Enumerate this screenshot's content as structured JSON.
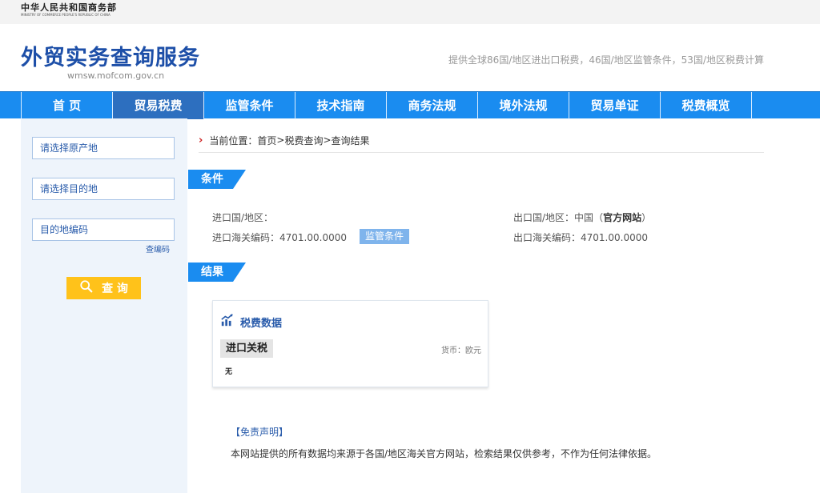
{
  "ministry": {
    "name_cn": "中华人民共和国商务部",
    "name_en": "MINISTRY OF COMMERCE PEOPLE'S REPUBLIC OF CHINA"
  },
  "header": {
    "title": "外贸实务查询服务",
    "url": "wmsw.mofcom.gov.cn",
    "description": "提供全球86国/地区进出口税费，46国/地区监管条件，53国/地区税费计算"
  },
  "nav": {
    "items": [
      "首 页",
      "贸易税费",
      "监管条件",
      "技术指南",
      "商务法规",
      "境外法规",
      "贸易单证",
      "税费概览"
    ],
    "active_index": 1
  },
  "sidebar": {
    "origin_placeholder": "请选择原产地",
    "destination_placeholder": "请选择目的地",
    "code_placeholder": "目的地编码",
    "code_link": "查编码",
    "query_button": "查 询"
  },
  "breadcrumb": {
    "prefix": "当前位置：",
    "home": "首页",
    "sep1": " > ",
    "level1": "税费查询",
    "sep2": " >",
    "current": "查询结果"
  },
  "conditions": {
    "section_label": "条件",
    "import_country_label": "进口国/地区：",
    "import_country_value": "",
    "import_code_label": "进口海关编码：",
    "import_code_value": "4701.00.0000",
    "supervise_button": "监管条件",
    "export_country_label": "出口国/地区：",
    "export_country_value": "中国",
    "official_site_open": "（",
    "official_site_link": "官方网站",
    "official_site_close": "）",
    "export_code_label": "出口海关编码：",
    "export_code_value": "4701.00.0000"
  },
  "result": {
    "section_label": "结果",
    "card_title": "税费数据",
    "tariff_label": "进口关税",
    "currency": "货币：欧元",
    "tariff_value": "无"
  },
  "disclaimer": {
    "title": "【免责声明】",
    "text": "本网站提供的所有数据均来源于各国/地区海关官方网站，检索结果仅供参考，不作为任何法律依据。"
  },
  "colors": {
    "nav_bg": "#1a8cf0",
    "nav_active": "#2d6fbf",
    "title_blue": "#1d4fa8",
    "button_yellow": "#ffc21a",
    "sidebar_bg": "#eef4fb"
  }
}
